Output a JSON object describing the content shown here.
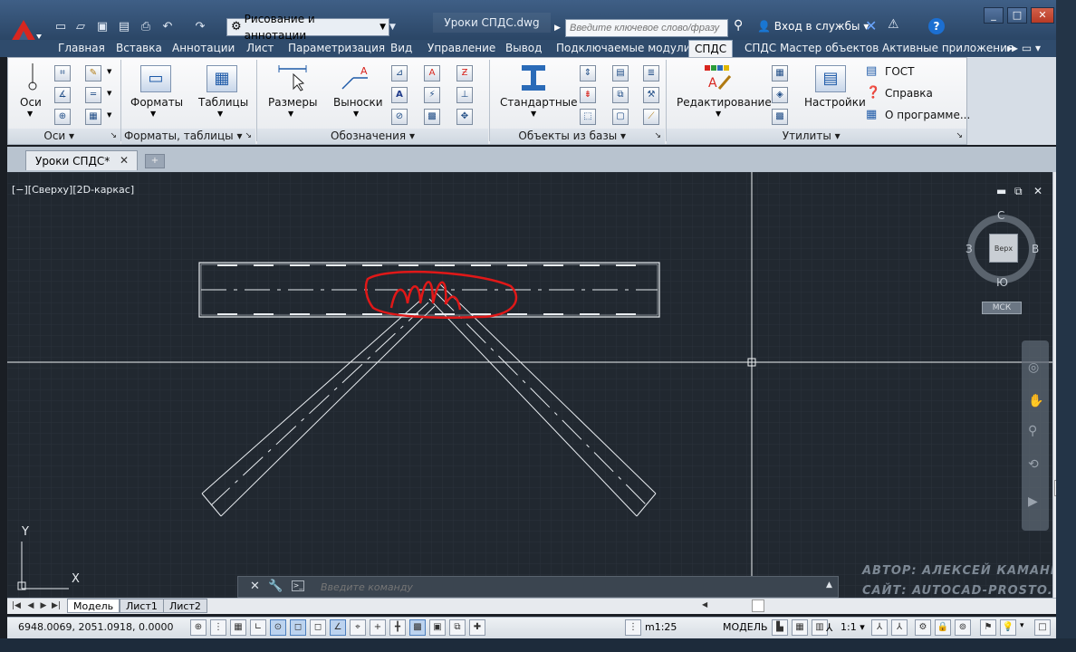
{
  "app": {
    "workspace": "Рисование и аннотации",
    "document_title": "Уроки СПДС.dwg",
    "search_placeholder": "Введите ключевое слово/фразу",
    "login": "Вход в службы",
    "help": "?"
  },
  "ribbon_tabs": [
    "Главная",
    "Вставка",
    "Аннотации",
    "Лист",
    "Параметризация",
    "Вид",
    "Управление",
    "Вывод",
    "Подключаемые модули",
    "СПДС",
    "СПДС Мастер объектов",
    "Активные приложения"
  ],
  "ribbon": {
    "axes_label": "Оси",
    "formats_label": "Форматы",
    "tables_label": "Таблицы",
    "dimensions_label": "Размеры",
    "leaders_label": "Выноски",
    "standard_label": "Стандартные",
    "editing_label": "Редактирование",
    "settings_label": "Настройки",
    "gost": "ГОСТ",
    "help": "Справка",
    "about": "О программе...",
    "panels": {
      "axes": "Оси",
      "formats_tables": "Форматы, таблицы",
      "designations": "Обозначения",
      "library": "Объекты из базы",
      "utilities": "Утилиты"
    }
  },
  "doc_tab": "Уроки СПДС*",
  "viewport": {
    "label": "[−][Сверху][2D-каркас]",
    "cube_top": "Верх",
    "north": "С",
    "south": "Ю",
    "east": "В",
    "west": "З",
    "wcs": "МСК",
    "axis_x": "X",
    "axis_y": "Y"
  },
  "watermark": {
    "author": "АВТОР: АЛЕКСЕЙ КАМАНИН",
    "site": "САЙТ: AUTOCAD-PROSTO.RU"
  },
  "command": {
    "placeholder": "Введите команду"
  },
  "layout_tabs": [
    "Модель",
    "Лист1",
    "Лист2"
  ],
  "status": {
    "coords": "6948.0069, 2051.0918, 0.0000",
    "scale": "m1:25",
    "model": "МОДЕЛЬ",
    "ratio": "1:1"
  }
}
